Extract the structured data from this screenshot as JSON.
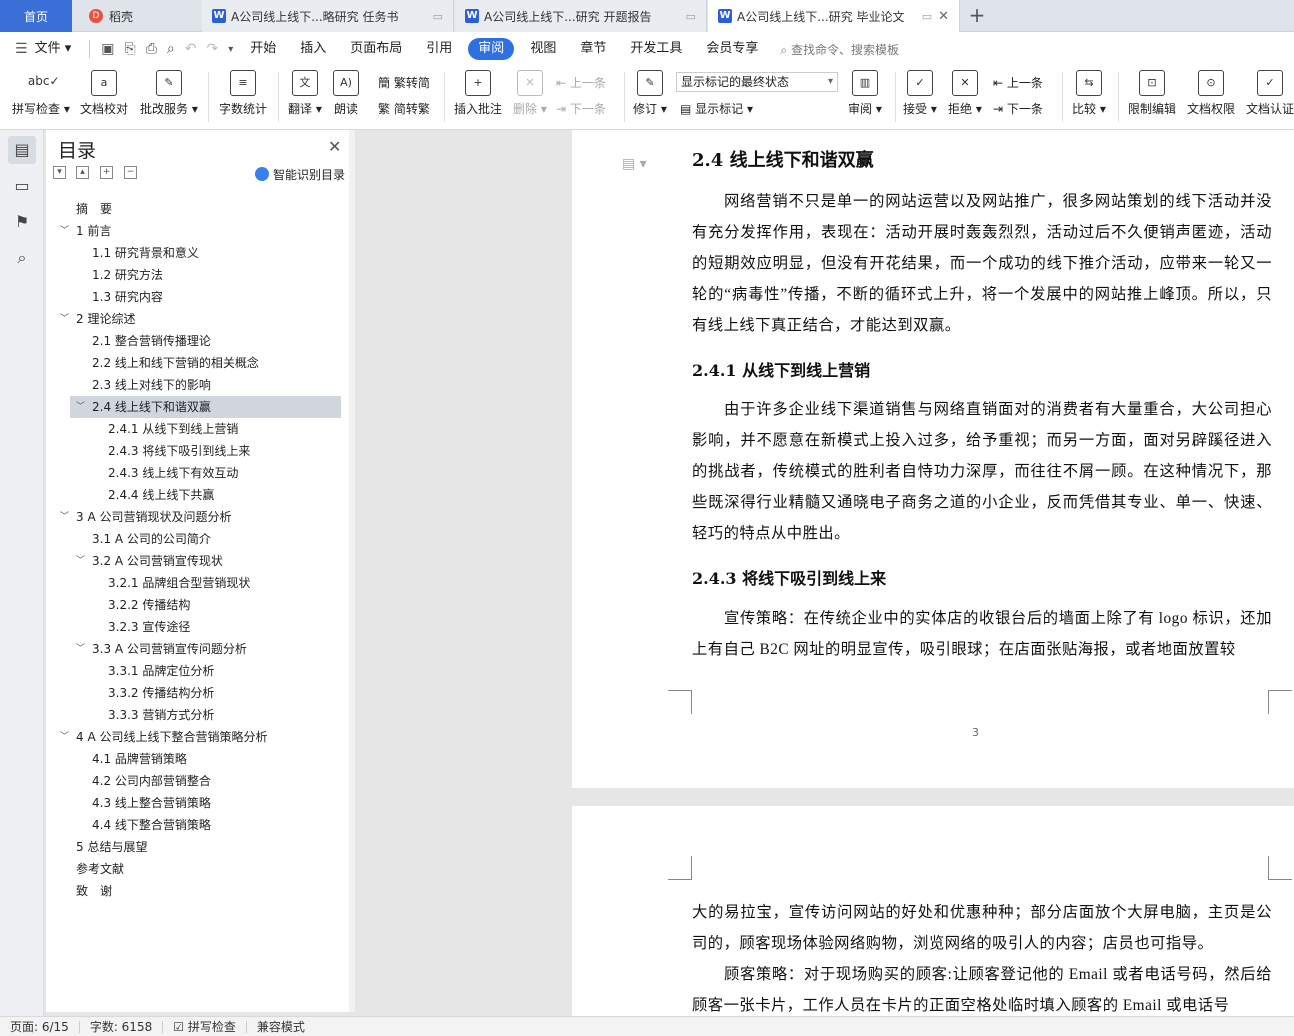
{
  "tabs": {
    "home": "首页",
    "shell": "稻壳",
    "docs": [
      {
        "label": "A公司线上线下...略研究 任务书",
        "active": false
      },
      {
        "label": "A公司线上线下...研究 开题报告",
        "active": false
      },
      {
        "label": "A公司线上线下...研究 毕业论文",
        "active": true
      }
    ],
    "new_tab": "+"
  },
  "menu": {
    "file": "文件",
    "items": [
      "开始",
      "插入",
      "页面布局",
      "引用",
      "审阅",
      "视图",
      "章节",
      "开发工具",
      "会员专享"
    ],
    "active": "审阅",
    "search": "查找命令、搜索模板"
  },
  "ribbon": {
    "spell": "拼写检查",
    "proof": "文档校对",
    "batch": "批改服务",
    "wordcount": "字数统计",
    "translate": "翻译",
    "read": "朗读",
    "to_trad": "繁转简",
    "to_simp": "简转繁",
    "insert_comment": "插入批注",
    "delete": "删除",
    "prev": "上一条",
    "next": "下一条",
    "revise": "修订",
    "mark_state": "显示标记的最终状态",
    "show_marks": "显示标记",
    "review": "审阅",
    "accept": "接受",
    "reject": "拒绝",
    "prev2": "上一条",
    "next2": "下一条",
    "compare": "比较",
    "restrict": "限制编辑",
    "perm": "文档权限",
    "cert": "文档认证"
  },
  "toc": {
    "title": "目录",
    "smart": "智能识别目录",
    "items": [
      {
        "text": "摘　要",
        "level": 0,
        "caret": false
      },
      {
        "text": "1 前言",
        "level": 0,
        "caret": true
      },
      {
        "text": "1.1 研究背景和意义",
        "level": 1,
        "caret": false
      },
      {
        "text": "1.2 研究方法",
        "level": 1,
        "caret": false
      },
      {
        "text": "1.3 研究内容",
        "level": 1,
        "caret": false
      },
      {
        "text": "2 理论综述",
        "level": 0,
        "caret": true
      },
      {
        "text": "2.1 整合营销传播理论",
        "level": 1,
        "caret": false
      },
      {
        "text": "2.2 线上和线下营销的相关概念",
        "level": 1,
        "caret": false
      },
      {
        "text": "2.3 线上对线下的影响",
        "level": 1,
        "caret": false
      },
      {
        "text": "2.4 线上线下和谐双赢",
        "level": 1,
        "caret": true,
        "selected": true
      },
      {
        "text": "2.4.1 从线下到线上营销",
        "level": 2,
        "caret": false
      },
      {
        "text": "2.4.3 将线下吸引到线上来",
        "level": 2,
        "caret": false
      },
      {
        "text": "2.4.3 线上线下有效互动",
        "level": 2,
        "caret": false
      },
      {
        "text": "2.4.4 线上线下共赢",
        "level": 2,
        "caret": false
      },
      {
        "text": "3 A 公司营销现状及问题分析",
        "level": 0,
        "caret": true
      },
      {
        "text": "3.1 A 公司的公司简介",
        "level": 1,
        "caret": false
      },
      {
        "text": "3.2 A 公司营销宣传现状",
        "level": 1,
        "caret": true
      },
      {
        "text": "3.2.1 品牌组合型营销现状",
        "level": 2,
        "caret": false
      },
      {
        "text": "3.2.2 传播结构",
        "level": 2,
        "caret": false
      },
      {
        "text": "3.2.3 宣传途径",
        "level": 2,
        "caret": false
      },
      {
        "text": "3.3 A 公司营销宣传问题分析",
        "level": 1,
        "caret": true
      },
      {
        "text": "3.3.1 品牌定位分析",
        "level": 2,
        "caret": false
      },
      {
        "text": "3.3.2 传播结构分析",
        "level": 2,
        "caret": false
      },
      {
        "text": "3.3.3 营销方式分析",
        "level": 2,
        "caret": false
      },
      {
        "text": "4 A 公司线上线下整合营销策略分析",
        "level": 0,
        "caret": true
      },
      {
        "text": "4.1 品牌营销策略",
        "level": 1,
        "caret": false
      },
      {
        "text": "4.2 公司内部营销整合",
        "level": 1,
        "caret": false
      },
      {
        "text": "4.3 线上整合营销策略",
        "level": 1,
        "caret": false
      },
      {
        "text": "4.4 线下整合营销策略",
        "level": 1,
        "caret": false
      },
      {
        "text": "5 总结与展望",
        "level": 0,
        "caret": false
      },
      {
        "text": "参考文献",
        "level": 0,
        "caret": false
      },
      {
        "text": "致　谢",
        "level": 0,
        "caret": false
      }
    ]
  },
  "doc": {
    "h_24": "2.4 线上线下和谐双赢",
    "p1": "网络营销不只是单一的网站运营以及网站推广，很多网站策划的线下活动并没有充分发挥作用，表现在：活动开展时轰轰烈烈，活动过后不久便销声匿迹，活动的短期效应明显，但没有开花结果，而一个成功的线下推介活动，应带来一轮又一轮的“病毒性”传播，不断的循环式上升，将一个发展中的网站推上峰顶。所以，只有线上线下真正结合，才能达到双赢。",
    "h_241": "2.4.1 从线下到线上营销",
    "p2": "由于许多企业线下渠道销售与网络直销面对的消费者有大量重合，大公司担心影响，并不愿意在新模式上投入过多，给予重视；而另一方面，面对另辟蹊径进入的挑战者，传统模式的胜利者自恃功力深厚，而往往不屑一顾。在这种情况下，那些既深得行业精髓又通晓电子商务之道的小企业，反而凭借其专业、单一、快速、轻巧的特点从中胜出。",
    "h_243": "2.4.3 将线下吸引到线上来",
    "p3": "宣传策略：在传统企业中的实体店的收银台后的墙面上除了有 logo 标识，还加上有自己 B2C 网址的明显宣传，吸引眼球；在店面张贴海报，或者地面放置较",
    "page_number": "3",
    "p4": "大的易拉宝，宣传访问网站的好处和优惠种种；部分店面放个大屏电脑，主页是公司的，顾客现场体验网络购物，浏览网络的吸引人的内容；店员也可指导。",
    "p5": "顾客策略：对于现场购买的顾客:让顾客登记他的 Email 或者电话号码，然后给顾客一张卡片，工作人员在卡片的正面空格处临时填入顾客的 Email 或电话号"
  },
  "status": {
    "page": "页面: 6/15",
    "words": "字数: 6158",
    "spell": "拼写检查",
    "compat": "兼容模式"
  }
}
